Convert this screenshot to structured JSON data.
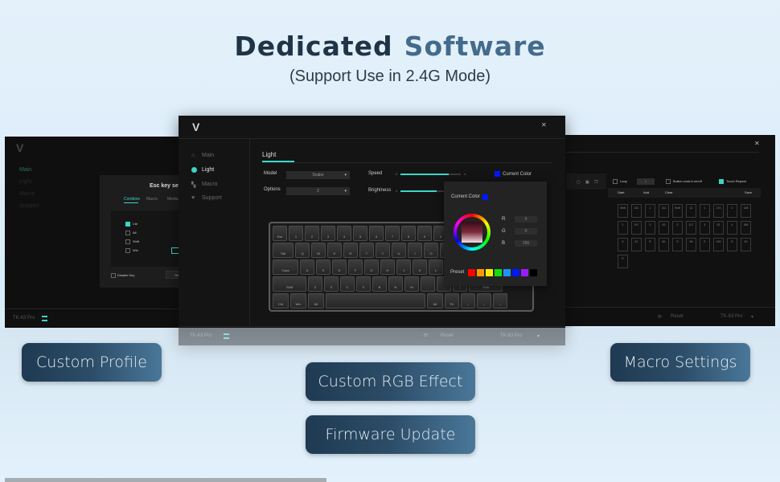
{
  "header": {
    "title_part1": "Dedicated",
    "title_part2": "Software",
    "subtitle": "(Support Use in 2.4G Mode)"
  },
  "main_window": {
    "sidebar": [
      {
        "label": "Main",
        "icon": "home-icon",
        "active": false
      },
      {
        "label": "Light",
        "icon": "bulb-icon",
        "active": true
      },
      {
        "label": "Macro",
        "icon": "macro-icon",
        "active": false
      },
      {
        "label": "Support",
        "icon": "heart-icon",
        "active": false
      }
    ],
    "tab": "Light",
    "model_label": "Model",
    "model_value": "Snake",
    "options_label": "Options",
    "options_value": "2",
    "speed_label": "Speed",
    "speed_min": "0",
    "speed_max": "4",
    "speed_fraction": 0.8,
    "brightness_label": "Brightness",
    "brightness_min": "0",
    "brightness_fraction": 0.6,
    "current_color_label": "Current Color",
    "current_color": "#0018ff",
    "popup": {
      "title": "Current Color",
      "r_label": "R",
      "r_value": "0",
      "g_label": "G",
      "g_value": "0",
      "b_label": "B",
      "b_value": "256",
      "preset_label": "Preset",
      "presets": [
        "#ff0000",
        "#ff9900",
        "#ffee00",
        "#11dd11",
        "#1e90ff",
        "#0018ff",
        "#9b1bff",
        "#000000"
      ]
    },
    "keyboard_rows": [
      [
        "Esc",
        "1",
        "2",
        "3",
        "4",
        "5",
        "6",
        "7",
        "8",
        "9",
        "0",
        "-",
        "=",
        "Back"
      ],
      [
        "Tab",
        "Q",
        "W",
        "E",
        "R",
        "T",
        "Y",
        "U",
        "I",
        "O",
        "P",
        "[",
        "]",
        "\\"
      ],
      [
        "Caps",
        "A",
        "S",
        "D",
        "F",
        "G",
        "H",
        "J",
        "K",
        "L",
        ";",
        "'",
        "Enter"
      ],
      [
        "Shift",
        "Z",
        "X",
        "C",
        "V",
        "B",
        "N",
        "M",
        ",",
        ".",
        "/",
        "Shift"
      ],
      [
        "Ctrl",
        "Win",
        "Alt",
        "",
        "Alt",
        "Fn",
        "←",
        "↓",
        "→"
      ]
    ],
    "footer_device": "TK-63 Pro",
    "reset_label": "Reset",
    "device_select": "TK-63 Pro"
  },
  "left_window": {
    "sidebar": [
      "Main",
      "Light",
      "Macro",
      "Support"
    ],
    "dialog_title": "Esc key set",
    "dialog_tabs": [
      "Combine",
      "Macro",
      "Media"
    ],
    "modifiers": [
      {
        "label": "Ctrl",
        "checked": true
      },
      {
        "label": "Alt",
        "checked": false
      },
      {
        "label": "Shift",
        "checked": false
      },
      {
        "label": "Win",
        "checked": false
      }
    ],
    "disable_key": "Disable Key",
    "reset_btn": "Re",
    "footer_device": "TK-63 Pro"
  },
  "right_window": {
    "loop_label": "Loop",
    "loop_count": "1",
    "button_control": "Button control on/off",
    "touch_repeat": "Touch Repeat",
    "toolbar": [
      "Start",
      "Add",
      "Clear",
      "Save"
    ],
    "macro_cells": [
      "Shift",
      "211",
      "1",
      "112",
      "Shift",
      "11",
      "1",
      "174",
      "1",
      "128",
      "1",
      "197",
      "2",
      "62",
      "2",
      "117",
      "4",
      "92",
      "4",
      "266",
      "5",
      "67",
      "R",
      "89",
      "R",
      "96",
      "E",
      "109",
      "E",
      "90",
      "E"
    ],
    "reset_label": "Reset",
    "device_select": "TK-63 Pro"
  },
  "features": {
    "custom_profile": "Custom Profile",
    "custom_rgb": "Custom RGB Effect",
    "firmware_update": "Firmware Update",
    "macro_settings": "Macro Settings"
  }
}
